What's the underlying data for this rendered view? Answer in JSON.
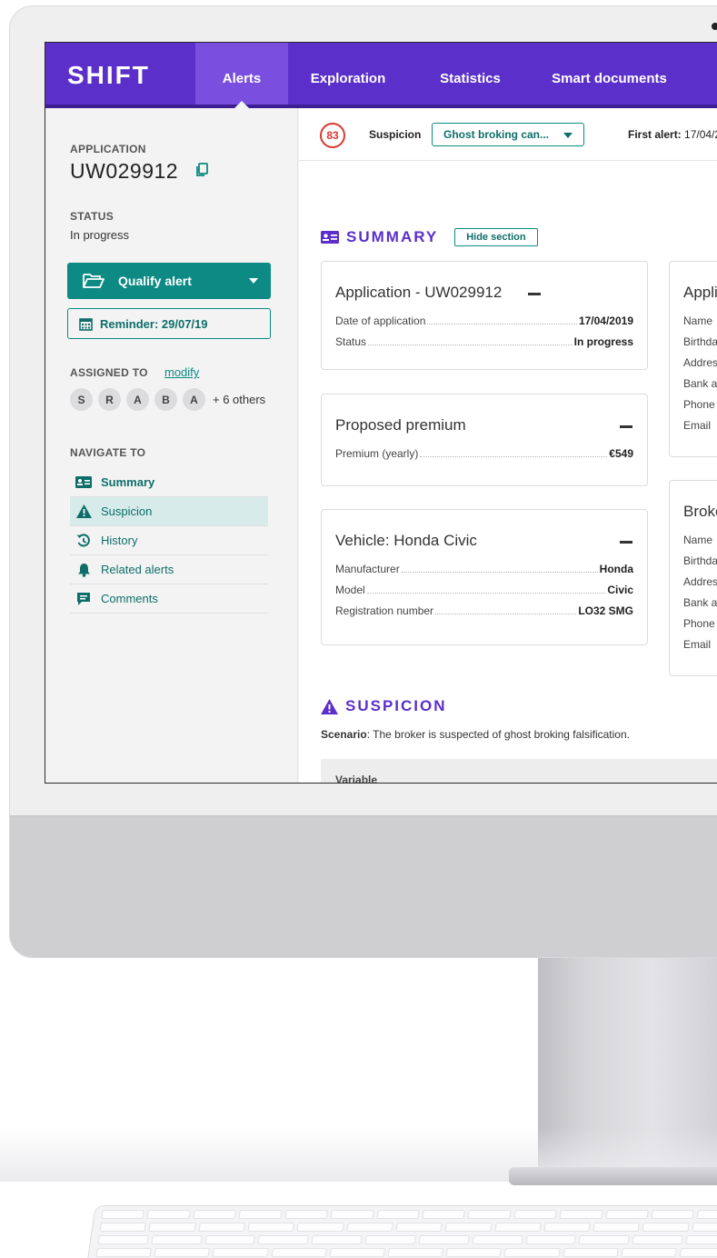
{
  "app": {
    "brand": "SHIFT",
    "colors": {
      "nav_bg": "#5b2fc9",
      "accent": "#0d8a83",
      "alert": "#d63a30"
    }
  },
  "nav": {
    "tabs": [
      {
        "label": "Alerts",
        "active": true
      },
      {
        "label": "Exploration",
        "active": false
      },
      {
        "label": "Statistics",
        "active": false
      },
      {
        "label": "Smart documents",
        "active": false
      }
    ]
  },
  "sidebar": {
    "application_label": "APPLICATION",
    "application_id": "UW029912",
    "status_label": "STATUS",
    "status_value": "In progress",
    "qualify_button": "Qualify alert",
    "reminder_button": "Reminder: 29/07/19",
    "assigned_label": "ASSIGNED TO",
    "modify_link": "modify",
    "avatars": [
      "S",
      "R",
      "A",
      "B",
      "A"
    ],
    "others_text": "+ 6 others",
    "navigate_label": "NAVIGATE TO",
    "nav_items": [
      {
        "label": "Summary",
        "icon": "id-card-icon",
        "bold": true
      },
      {
        "label": "Suspicion",
        "icon": "warning-icon",
        "active": true
      },
      {
        "label": "History",
        "icon": "history-icon"
      },
      {
        "label": "Related alerts",
        "icon": "bell-icon"
      },
      {
        "label": "Comments",
        "icon": "comment-icon"
      }
    ]
  },
  "alertbar": {
    "score": "83",
    "suspicion_label": "Suspicion",
    "suspicion_value": "Ghost broking can...",
    "first_alert_label": "First alert:",
    "first_alert_value": "17/04/2"
  },
  "summary": {
    "title": "SUMMARY",
    "hide_button": "Hide section",
    "application_card": {
      "title": "Application - UW029912",
      "rows": [
        {
          "label": "Date of application",
          "value": "17/04/2019"
        },
        {
          "label": "Status",
          "value": "In progress"
        }
      ]
    },
    "premium_card": {
      "title": "Proposed premium",
      "rows": [
        {
          "label": "Premium (yearly)",
          "value": "€549"
        }
      ]
    },
    "vehicle_card": {
      "title": "Vehicle: Honda Civic",
      "rows": [
        {
          "label": "Manufacturer",
          "value": "Honda"
        },
        {
          "label": "Model",
          "value": "Civic"
        },
        {
          "label": "Registration number",
          "value": "LO32 SMG"
        }
      ]
    },
    "applicant_card": {
      "title": "Appli",
      "rows": [
        "Name",
        "Birthda",
        "Addres",
        "Bank a",
        "Phone",
        "Email"
      ]
    },
    "broker_card": {
      "title": "Broke",
      "rows": [
        "Name",
        "Birthda",
        "Addres",
        "Bank a",
        "Phone",
        "Email"
      ]
    }
  },
  "suspicion": {
    "title": "SUSPICION",
    "scenario_label": "Scenario",
    "scenario_text": ": The broker is suspected of ghost broking falsification.",
    "table_header": "Variable"
  }
}
